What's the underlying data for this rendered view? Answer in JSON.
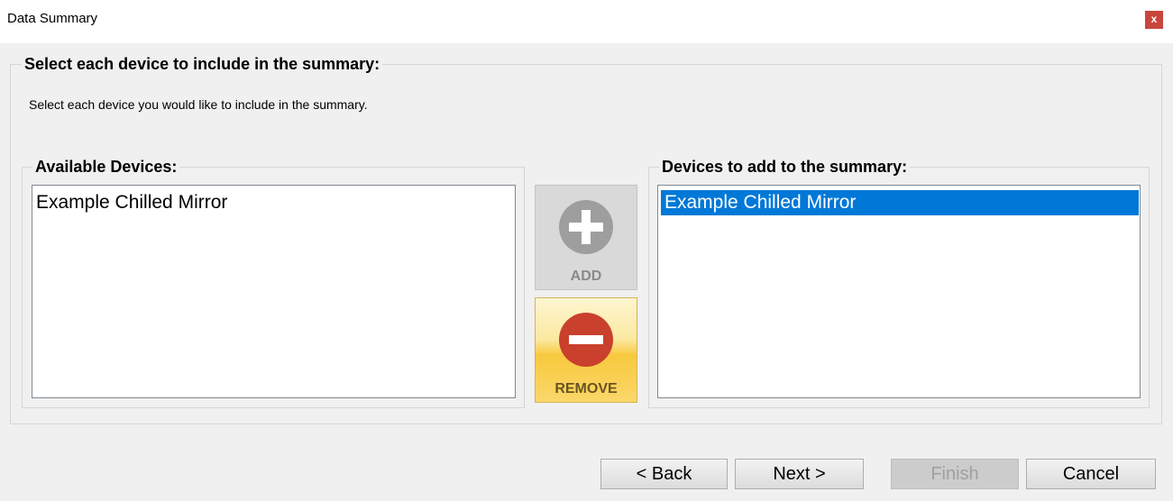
{
  "window": {
    "title": "Data Summary",
    "close_label": "x"
  },
  "main_group": {
    "legend": "Select each device to include in the summary:",
    "instruction": "Select each device you would like to include in the summary."
  },
  "available": {
    "legend": "Available Devices:",
    "items": [
      {
        "label": "Example Chilled Mirror",
        "selected": false
      }
    ]
  },
  "selected_devices": {
    "legend": "Devices to add to the summary:",
    "items": [
      {
        "label": "Example Chilled Mirror",
        "selected": true
      }
    ]
  },
  "actions": {
    "add_label": "ADD",
    "add_icon": "plus-circle-icon",
    "add_enabled": false,
    "remove_label": "REMOVE",
    "remove_icon": "minus-circle-icon",
    "remove_enabled": true
  },
  "footer": {
    "back_label": "< Back",
    "next_label": "Next >",
    "finish_label": "Finish",
    "finish_enabled": false,
    "cancel_label": "Cancel"
  },
  "colors": {
    "selection": "#0078d7",
    "close_button": "#c8463d",
    "remove_icon": "#c9402c",
    "add_icon_disabled": "#9e9e9e"
  }
}
